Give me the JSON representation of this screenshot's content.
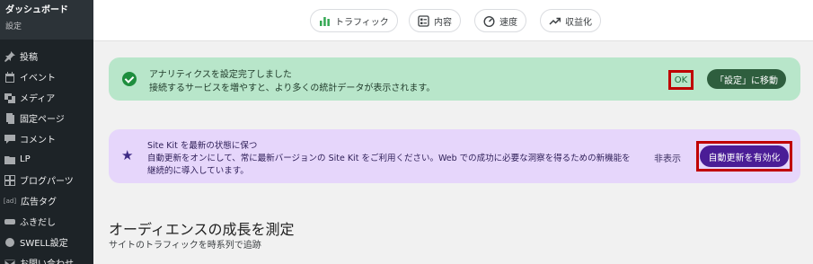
{
  "sidebar": {
    "title": "ダッシュボード",
    "subtitle": "設定",
    "items": [
      {
        "label": "投稿",
        "icon": "pin-icon"
      },
      {
        "label": "イベント",
        "icon": "calendar-icon"
      },
      {
        "label": "メディア",
        "icon": "media-icon"
      },
      {
        "label": "固定ページ",
        "icon": "page-icon"
      },
      {
        "label": "コメント",
        "icon": "comment-icon"
      },
      {
        "label": "LP",
        "icon": "folder-icon"
      },
      {
        "label": "ブログパーツ",
        "icon": "grid-icon"
      },
      {
        "label": "広告タグ",
        "icon": "ad-icon",
        "icon_text": "[ad]"
      },
      {
        "label": "ふきだし",
        "icon": "speech-bubble-icon"
      },
      {
        "label": "SWELL設定",
        "icon": "swell-icon"
      },
      {
        "label": "お問い合わせ",
        "icon": "mail-icon"
      }
    ]
  },
  "tabs": [
    {
      "label": "トラフィック",
      "icon": "bar-chart-icon"
    },
    {
      "label": "内容",
      "icon": "content-icon"
    },
    {
      "label": "速度",
      "icon": "speedometer-icon"
    },
    {
      "label": "収益化",
      "icon": "trending-up-icon"
    }
  ],
  "analytics_notice": {
    "title": "アナリティクスを設定完了しました",
    "description": "接続するサービスを増やすと、より多くの統計データが表示されます。",
    "ok_label": "OK",
    "settings_label": "「設定」に移動"
  },
  "update_notice": {
    "title": "Site Kit を最新の状態に保つ",
    "description_line1": "自動更新をオンにして、常に最新バージョンの Site Kit をご利用ください。Web での成功に必要な洞察を得るための新機能を",
    "description_line2": "継続的に導入しています。",
    "dismiss_label": "非表示",
    "enable_label": "自動更新を有効化"
  },
  "section": {
    "title": "オーディエンスの成長を測定",
    "subtitle": "サイトのトラフィックを時系列で追跡"
  },
  "colors": {
    "sidebar_bg": "#1d2327",
    "green_notice": "#b8e6ca",
    "purple_notice": "#e6d6fb",
    "highlight_red": "#c00000",
    "enable_button": "#4a1d96"
  }
}
